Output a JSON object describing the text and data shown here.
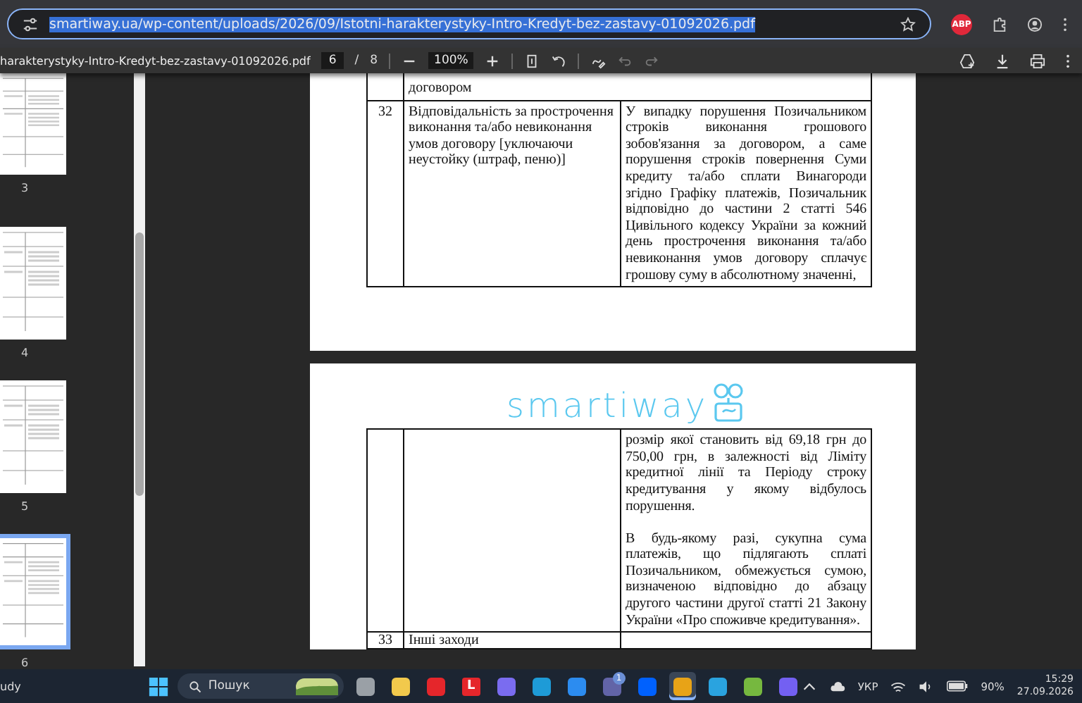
{
  "browser": {
    "url": "smartiway.ua/wp-content/uploads/2026/09/Istotni-harakterystyky-Intro-Kredyt-bez-zastavy-01092026.pdf",
    "url_selected": true,
    "extension_badge": "ABP"
  },
  "pdf_toolbar": {
    "title": "harakterystyky-Intro-Kredyt-bez-zastavy-01092026.pdf",
    "page": "6",
    "separator": "/",
    "total": "8",
    "zoom": "100%"
  },
  "thumbnails": [
    {
      "label": "3",
      "selected": false
    },
    {
      "label": "4",
      "selected": false
    },
    {
      "label": "5",
      "selected": false
    },
    {
      "label": "6",
      "selected": true
    }
  ],
  "page_a": {
    "rows": [
      {
        "number": "",
        "title": "договором",
        "text": []
      },
      {
        "number": "32",
        "title": "Відповідальність за прострочення виконання та/або невиконання умов договору [уключаючи неустойку (штраф, пеню)]",
        "text": [
          "У випадку порушення Позичальником строків виконання грошового зобов'язання за договором, а саме порушення строків повернення Суми кредиту та/або сплати Винагороди згідно Графіку платежів, Позичальник відповідно до частини 2 статті 546 Цивільного кодексу України за кожний день прострочення виконання та/або невиконання умов договору сплачує грошову суму в абсолютному значенні,"
        ]
      }
    ]
  },
  "page_b": {
    "logo": "smartiway",
    "rows": [
      {
        "number": "",
        "title": "",
        "text": [
          "розмір якої становить від 69,18 грн до 750,00 грн, в залежності від Ліміту кредитної лінії та Періоду строку кредитування у якому відбулось порушення.",
          "В будь-якому разі, сукупна сума платежів, що підлягають сплаті Позичальником, обмежується сумою, визначеною відповідно до абзацу другого частини другої статті 21 Закону України «Про споживче кредитування»."
        ]
      },
      {
        "number": "33",
        "title": "Інші заходи",
        "text": []
      }
    ]
  },
  "taskbar": {
    "weather": "udy",
    "search_placeholder": "Пошук",
    "apps": [
      {
        "kind": "taskview",
        "selected": false
      },
      {
        "kind": "folder",
        "selected": false
      },
      {
        "kind": "opera",
        "selected": false
      },
      {
        "kind": "letter",
        "selected": false,
        "label": "L"
      },
      {
        "kind": "copilot",
        "selected": false
      },
      {
        "kind": "edge",
        "selected": false
      },
      {
        "kind": "store",
        "selected": false
      },
      {
        "kind": "teams",
        "selected": false,
        "badge": "1"
      },
      {
        "kind": "dropbox",
        "selected": false
      },
      {
        "kind": "chrome",
        "selected": true
      },
      {
        "kind": "telegram",
        "selected": false
      },
      {
        "kind": "torrent",
        "selected": false
      },
      {
        "kind": "viber",
        "selected": false
      }
    ],
    "language": "УКР",
    "battery": "90%",
    "time": "15:29",
    "date": "27.09.2026"
  }
}
